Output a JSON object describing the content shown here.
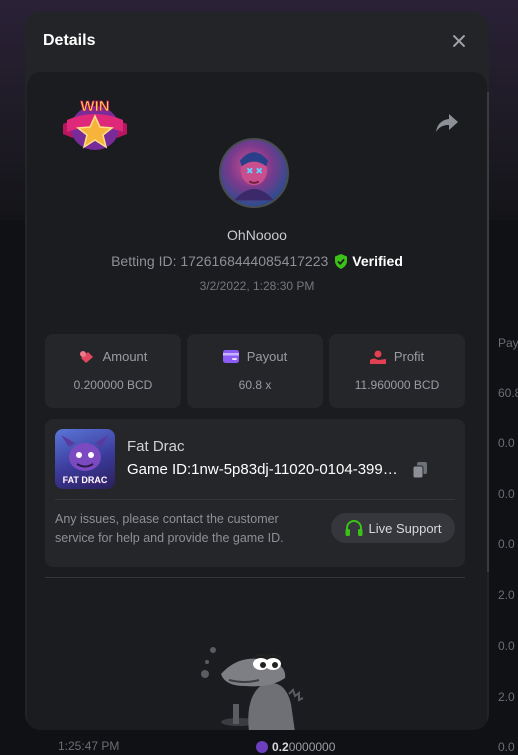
{
  "background": {
    "side_header": "Pay",
    "side_values": [
      "60.8",
      "0.0",
      "0.0",
      "0.0",
      "2.0",
      "0.0",
      "2.0",
      "0.0"
    ],
    "bottom_time": "1:25:47 PM",
    "bottom_amount_strong": "0.2",
    "bottom_amount_rest": "0000000"
  },
  "modal": {
    "title": "Details",
    "close_icon": "close-icon"
  },
  "player": {
    "badge_text": "WIN",
    "username": "OhNoooo",
    "betting_id_label": "Betting ID: 1726168444085417223",
    "verified_label": "Verified",
    "date": "3/2/2022, 1:28:30 PM"
  },
  "stats": [
    {
      "label": "Amount",
      "value": "0.200000 BCD",
      "icon": "amount-icon",
      "color": "#e2485f"
    },
    {
      "label": "Payout",
      "value": "60.8 x",
      "icon": "payout-icon",
      "color": "#8b5cf6"
    },
    {
      "label": "Profit",
      "value": "11.960000 BCD",
      "icon": "profit-icon",
      "color": "#e0404f"
    }
  ],
  "game": {
    "thumb_label": "FAT DRAC",
    "name": "Fat Drac",
    "game_id": "Game ID:1nw-5p83dj-11020-0104-3991...",
    "help_text": "Any issues, please contact the customer service for help and provide the game ID.",
    "support_label": "Live Support"
  },
  "colors": {
    "accent_green": "#3bc117",
    "modal_bg": "#232427",
    "card_bg": "#1b1c1f"
  }
}
